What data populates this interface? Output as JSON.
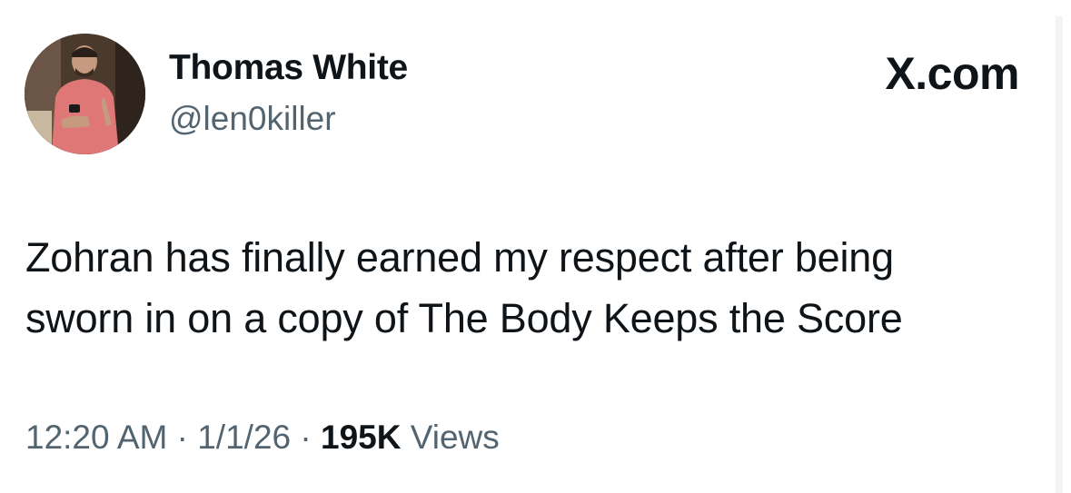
{
  "author": {
    "name": "Thomas White",
    "handle": "@len0killer"
  },
  "brand": "X.com",
  "tweet": {
    "text_line1": "Zohran has finally earned my respect after being",
    "text_line2": "sworn in on a copy of The Body Keeps the Score"
  },
  "meta": {
    "time": "12:20 AM",
    "separator": "·",
    "date": "1/1/26",
    "views_count": "195K",
    "views_label": "Views"
  },
  "colors": {
    "text_primary": "#0f1419",
    "text_secondary": "#536471",
    "background": "#ffffff"
  }
}
